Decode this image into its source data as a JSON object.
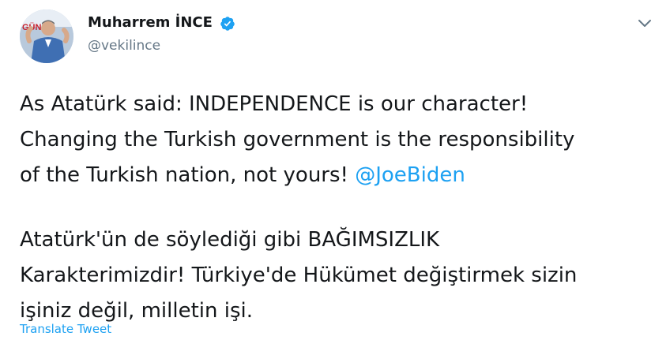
{
  "user": {
    "display_name": "Muharrem İNCE",
    "handle": "@vekilince",
    "verified": true,
    "avatar_sign_text": "GÜN"
  },
  "tweet": {
    "en_line1": "As Atatürk said: INDEPENDENCE is our character!",
    "en_line2": "Changing the Turkish government is the responsibility",
    "en_line3": "of the Turkish nation, not yours! ",
    "mention": "@JoeBiden",
    "tr_line1": "Atatürk'ün de söylediği gibi BAĞIMSIZLIK",
    "tr_line2": "Karakterimizdir! Türkiye'de Hükümet değiştirmek sizin",
    "tr_line3": "işiniz değil, milletin işi."
  },
  "actions": {
    "translate_label": "Translate Tweet"
  },
  "icons": {
    "verified": "verified-badge-icon",
    "more": "chevron-down-icon"
  },
  "colors": {
    "link": "#1da1f2",
    "text": "#14171a",
    "secondary": "#657786"
  }
}
